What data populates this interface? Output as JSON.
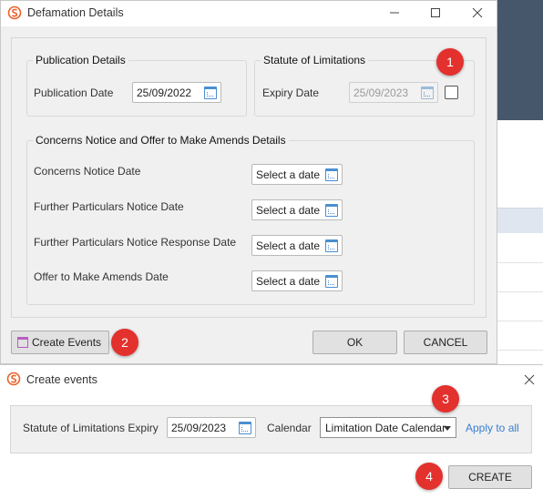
{
  "defamation_dialog": {
    "title": "Defamation Details",
    "publication_group": {
      "title": "Publication Details",
      "publication_date_label": "Publication Date",
      "publication_date_value": "25/09/2022"
    },
    "statute_group": {
      "title": "Statute of Limitations",
      "expiry_date_label": "Expiry Date",
      "expiry_date_value": "25/09/2023"
    },
    "concerns_group": {
      "title": "Concerns Notice and Offer to Make Amends Details",
      "rows": [
        {
          "label": "Concerns Notice Date",
          "placeholder": "Select a date"
        },
        {
          "label": "Further Particulars Notice Date",
          "placeholder": "Select a date"
        },
        {
          "label": "Further Particulars Notice Response Date",
          "placeholder": "Select a date"
        },
        {
          "label": "Offer to Make Amends Date",
          "placeholder": "Select a date"
        }
      ]
    },
    "buttons": {
      "create_events": "Create Events",
      "ok": "OK",
      "cancel": "CANCEL"
    }
  },
  "create_events_dialog": {
    "title": "Create events",
    "row_label": "Statute of Limitations Expiry",
    "date_value": "25/09/2023",
    "calendar_label": "Calendar",
    "calendar_selected": "Limitation Date Calendar",
    "apply_to_all": "Apply to all",
    "create_button": "CREATE"
  },
  "badges": [
    "1",
    "2",
    "3",
    "4"
  ],
  "colors": {
    "badge": "#e3312e",
    "link": "#3a7fd0",
    "calendar_icon": "#4a8fd1",
    "app_header": "#47576b"
  }
}
